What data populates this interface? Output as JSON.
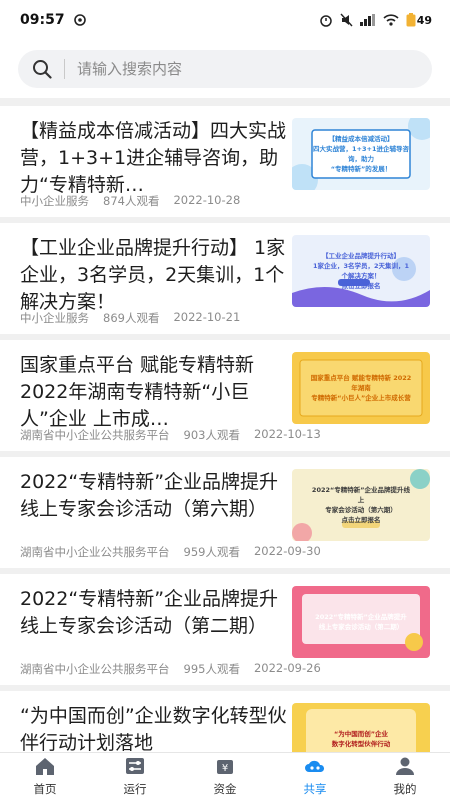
{
  "status": {
    "time": "09:57",
    "battery": "49"
  },
  "search": {
    "placeholder": "请输入搜索内容"
  },
  "articles": [
    {
      "title": "【精益成本倍减活动】四大实战营，1+3+1进企辅导咨询，助力“专精特新…",
      "source": "中小企业服务",
      "views": "874人观看",
      "date": "2022-10-28",
      "thumb": {
        "bg": "#e8f3fb",
        "line1": "【精益成本倍减活动】",
        "line2": "四大实战营，1+3+1进企辅导咨询，助力",
        "line3": "“专精特新”的发展！"
      }
    },
    {
      "title": "【工业企业品牌提升行动】 1家企业，3名学员，2天集训，1个解决方案！",
      "source": "中小企业服务",
      "views": "869人观看",
      "date": "2022-10-21",
      "thumb": {
        "bg": "#eaf0fb",
        "line1": "【工业企业品牌提升行动】",
        "line2": "1家企业，3名学员，2天集训，1个解决方案！",
        "line3": "点击立即报名"
      }
    },
    {
      "title": "国家重点平台 赋能专精特新 2022年湖南专精特新“小巨人”企业 上市成…",
      "source": "湖南省中小企业公共服务平台",
      "views": "903人观看",
      "date": "2022-10-13",
      "thumb": {
        "bg": "#f7c94a",
        "line1": "国家重点平台 赋能专精特新 2022年湖南",
        "line2": "专精特新“小巨人”企业上市成长营",
        "line3": ""
      }
    },
    {
      "title": "2022“专精特新”企业品牌提升线上专家会诊活动（第六期）",
      "source": "湖南省中小企业公共服务平台",
      "views": "959人观看",
      "date": "2022-09-30",
      "thumb": {
        "bg": "#f6efcf",
        "line1": "2022“专精特新”企业品牌提升线上",
        "line2": "专家会诊活动（第六期）",
        "line3": "点击立即报名"
      }
    },
    {
      "title": "2022“专精特新”企业品牌提升线上专家会诊活动（第二期）",
      "source": "湖南省中小企业公共服务平台",
      "views": "995人观看",
      "date": "2022-09-26",
      "thumb": {
        "bg": "#f06a8a",
        "line1": "2022“专精特新”企业品牌提升",
        "line2": "线上专家会诊活动（第二期）",
        "line3": ""
      }
    },
    {
      "title": "“为中国而创”企业数字化转型伙伴行动计划落地",
      "source": "",
      "views": "",
      "date": "",
      "thumb": {
        "bg": "#f7d04f",
        "line1": "“为中国而创”企业",
        "line2": "数字化转型伙伴行动",
        "line3": ""
      }
    }
  ],
  "tabs": [
    {
      "label": "首页",
      "icon": "home-icon"
    },
    {
      "label": "运行",
      "icon": "sliders-icon"
    },
    {
      "label": "资金",
      "icon": "money-icon"
    },
    {
      "label": "共享",
      "icon": "share-cloud-icon",
      "active": true
    },
    {
      "label": "我的",
      "icon": "user-icon"
    }
  ]
}
